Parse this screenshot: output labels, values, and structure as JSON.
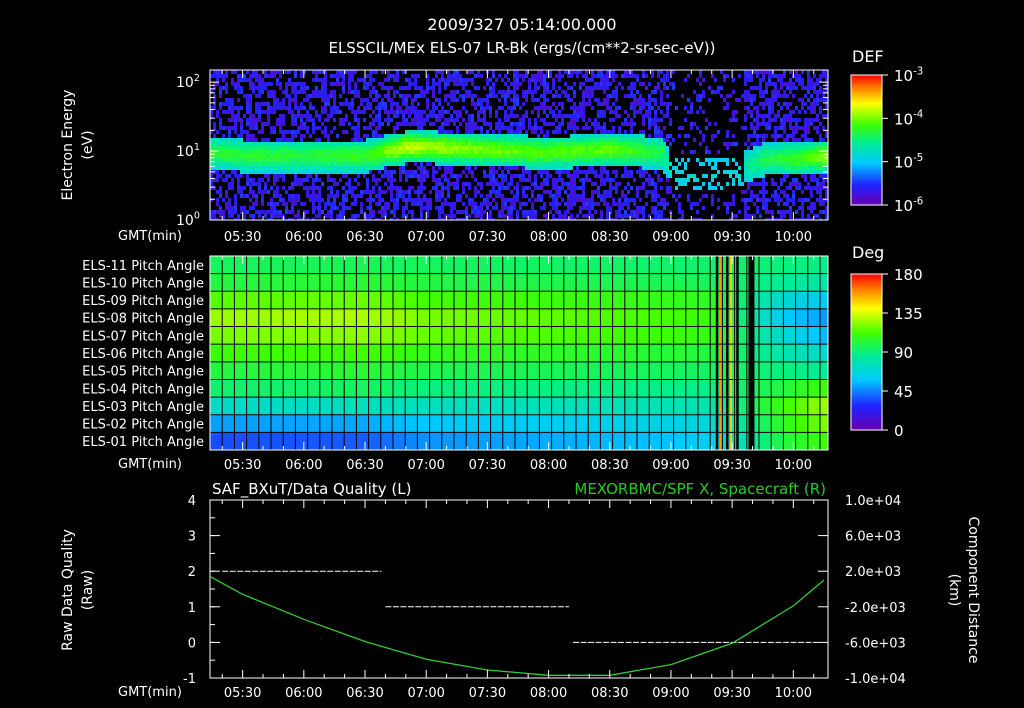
{
  "header": {
    "title_line1": "2009/327 05:14:00.000",
    "title_line2": "ELSSCIL/MEx ELS-07 LR-Bk  (ergs/(cm**2-sr-sec-eV))"
  },
  "time_axis": {
    "label": "GMT(min)",
    "ticks": [
      "05:30",
      "06:00",
      "06:30",
      "07:00",
      "07:30",
      "08:00",
      "08:30",
      "09:00",
      "09:30",
      "10:00"
    ]
  },
  "colors": {
    "background": "#000000",
    "green_trace": "#33cc33",
    "white_trace": "#ffffff",
    "right_title": "#22cc22"
  },
  "chart_data": [
    {
      "type": "heatmap",
      "name": "energy-spectrogram",
      "ylabel_line1": "Electron Energy",
      "ylabel_line2": "(eV)",
      "y_scale": "log",
      "ylim": [
        1,
        150
      ],
      "y_ticks": [
        {
          "base": "10",
          "exp": "0",
          "value": 1
        },
        {
          "base": "10",
          "exp": "1",
          "value": 10
        },
        {
          "base": "10",
          "exp": "2",
          "value": 100
        }
      ],
      "colorbar": {
        "title": "DEF",
        "ticks": [
          {
            "base": "10",
            "exp": "-3",
            "value": 0.001
          },
          {
            "base": "10",
            "exp": "-4",
            "value": 0.0001
          },
          {
            "base": "10",
            "exp": "-5",
            "value": 1e-05
          },
          {
            "base": "10",
            "exp": "-6",
            "value": 1e-06
          }
        ]
      },
      "columns": [
        {
          "t": "05:14",
          "peak_energy": 10,
          "level": 0.45
        },
        {
          "t": "05:30",
          "peak_energy": 9,
          "level": 0.45
        },
        {
          "t": "06:00",
          "peak_energy": 9,
          "level": 0.45
        },
        {
          "t": "06:30",
          "peak_energy": 9,
          "level": 0.5
        },
        {
          "t": "06:50",
          "peak_energy": 12,
          "level": 0.75
        },
        {
          "t": "07:00",
          "peak_energy": 12,
          "level": 0.7
        },
        {
          "t": "07:30",
          "peak_energy": 11,
          "level": 0.62
        },
        {
          "t": "08:00",
          "peak_energy": 10,
          "level": 0.55
        },
        {
          "t": "08:30",
          "peak_energy": 11,
          "level": 0.6
        },
        {
          "t": "08:55",
          "peak_energy": 10,
          "level": 0.4
        },
        {
          "t": "09:00",
          "peak_energy": 5,
          "level": 0.1
        },
        {
          "t": "09:30",
          "peak_energy": 5,
          "level": 0.1
        },
        {
          "t": "09:45",
          "peak_energy": 8,
          "level": 0.4
        },
        {
          "t": "10:00",
          "peak_energy": 8,
          "level": 0.5
        },
        {
          "t": "10:15",
          "peak_energy": 9,
          "level": 0.65
        }
      ]
    },
    {
      "type": "heatmap",
      "name": "pitch-angle",
      "row_labels": [
        "ELS-11 Pitch Angle",
        "ELS-10 Pitch Angle",
        "ELS-09 Pitch Angle",
        "ELS-08 Pitch Angle",
        "ELS-07 Pitch Angle",
        "ELS-06 Pitch Angle",
        "ELS-05 Pitch Angle",
        "ELS-04 Pitch Angle",
        "ELS-03 Pitch Angle",
        "ELS-02 Pitch Angle",
        "ELS-01 Pitch Angle"
      ],
      "colorbar": {
        "title": "Deg",
        "ticks": [
          "180",
          "135",
          "90",
          "45",
          "0"
        ],
        "range": [
          0,
          180
        ]
      },
      "time_nodes": [
        "05:14",
        "06:30",
        "07:00",
        "09:00",
        "09:20",
        "09:55",
        "10:15"
      ],
      "values": [
        [
          95,
          97,
          95,
          93,
          93,
          90,
          88
        ],
        [
          100,
          103,
          100,
          97,
          96,
          85,
          80
        ],
        [
          115,
          118,
          112,
          107,
          105,
          70,
          60
        ],
        [
          125,
          128,
          120,
          112,
          110,
          60,
          50
        ],
        [
          120,
          123,
          117,
          110,
          108,
          70,
          55
        ],
        [
          110,
          112,
          107,
          102,
          100,
          80,
          70
        ],
        [
          100,
          103,
          98,
          95,
          94,
          90,
          85
        ],
        [
          92,
          95,
          90,
          88,
          88,
          100,
          110
        ],
        [
          72,
          75,
          75,
          77,
          78,
          110,
          125
        ],
        [
          50,
          52,
          58,
          65,
          68,
          105,
          120
        ],
        [
          35,
          38,
          48,
          57,
          62,
          100,
          110
        ]
      ]
    },
    {
      "type": "line",
      "name": "data-quality-distance",
      "title_left": "SAF_BXuT/Data Quality (L)",
      "title_right": "MEXORBMC/SPF X, Spacecraft (R)",
      "ylabel_left_line1": "Raw Data Quality",
      "ylabel_left_line2": "(Raw)",
      "ylabel_right_line1": "Component Distance",
      "ylabel_right_line2": "(km)",
      "ylim_left": [
        -1,
        4
      ],
      "y_ticks_left": [
        "4",
        "3",
        "2",
        "1",
        "0",
        "-1"
      ],
      "ylim_right": [
        -10000,
        10000
      ],
      "y_ticks_right": [
        "1.0e+04",
        "6.0e+03",
        "2.0e+03",
        "-2.0e+03",
        "-6.0e+03",
        "-1.0e+04"
      ],
      "quality_series": [
        {
          "t_start": "05:20",
          "t_end": "06:38",
          "value": 2
        },
        {
          "t_start": "06:40",
          "t_end": "08:10",
          "value": 1
        },
        {
          "t_start": "08:12",
          "t_end": "10:12",
          "value": 0
        }
      ],
      "distance_series": {
        "t": [
          "05:14",
          "05:30",
          "06:00",
          "06:30",
          "07:00",
          "07:30",
          "08:00",
          "08:30",
          "09:00",
          "09:30",
          "10:00",
          "10:15"
        ],
        "km": [
          1400,
          -600,
          -3400,
          -5900,
          -7900,
          -9100,
          -9700,
          -9700,
          -8500,
          -6100,
          -1900,
          1000
        ]
      }
    }
  ]
}
